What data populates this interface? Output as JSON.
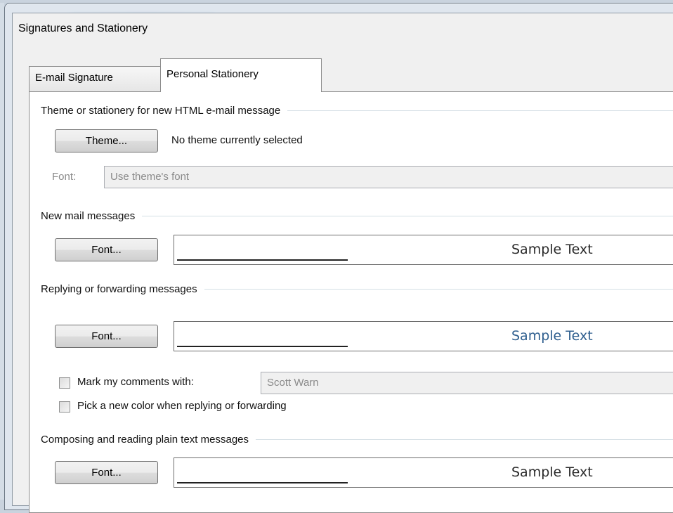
{
  "dialog": {
    "title": "Signatures and Stationery"
  },
  "tabs": [
    {
      "label": "E-mail Signature",
      "active": false
    },
    {
      "label": "Personal Stationery",
      "active": true
    }
  ],
  "theme_section": {
    "heading": "Theme or stationery for new HTML e-mail message",
    "theme_button": "Theme...",
    "theme_status": "No theme currently selected",
    "font_label": "Font:",
    "font_value": "Use theme's font"
  },
  "new_mail": {
    "heading": "New mail messages",
    "font_button": "Font...",
    "sample": "Sample Text",
    "sample_color": "#2a2a2a"
  },
  "replying": {
    "heading": "Replying or forwarding messages",
    "font_button": "Font...",
    "sample": "Sample Text",
    "sample_color": "#2f5f8f",
    "mark_comments_label": "Mark my comments with:",
    "mark_comments_value": "Scott Warn",
    "mark_comments_checked": false,
    "pick_color_label": "Pick a new color when replying or forwarding",
    "pick_color_checked": false
  },
  "plain_text": {
    "heading": "Composing and reading plain text messages",
    "font_button": "Font...",
    "sample": "Sample Text",
    "sample_color": "#2a2a2a"
  }
}
